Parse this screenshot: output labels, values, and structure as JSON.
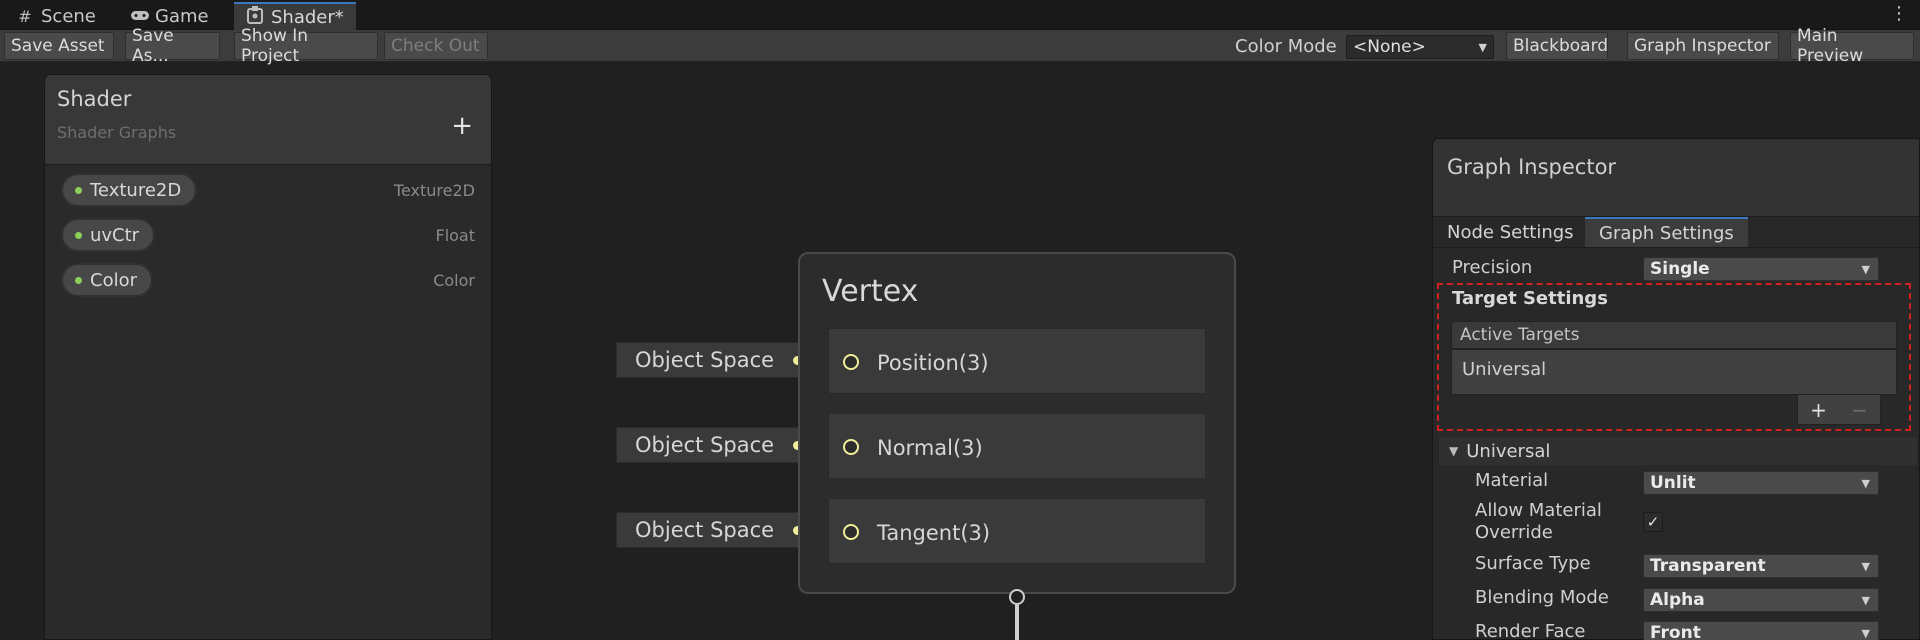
{
  "tabs": [
    {
      "label": "Scene",
      "icon": "hash-icon"
    },
    {
      "label": "Game",
      "icon": "gamepad-icon"
    },
    {
      "label": "Shader*",
      "icon": "shader-icon"
    }
  ],
  "toolbar": {
    "save_asset": "Save Asset",
    "save_as": "Save As...",
    "show_in_project": "Show In Project",
    "check_out": "Check Out",
    "color_mode_label": "Color Mode",
    "color_mode_value": "<None>",
    "blackboard": "Blackboard",
    "graph_inspector": "Graph Inspector",
    "main_preview": "Main Preview"
  },
  "blackboard": {
    "title": "Shader",
    "subtitle": "Shader Graphs",
    "properties": [
      {
        "name": "Texture2D",
        "type": "Texture2D"
      },
      {
        "name": "uvCtr",
        "type": "Float"
      },
      {
        "name": "Color",
        "type": "Color"
      }
    ]
  },
  "vertex_node": {
    "title": "Vertex",
    "slots": [
      {
        "label": "Position(3)",
        "input": "Object Space"
      },
      {
        "label": "Normal(3)",
        "input": "Object Space"
      },
      {
        "label": "Tangent(3)",
        "input": "Object Space"
      }
    ]
  },
  "inspector": {
    "title": "Graph Inspector",
    "tab_node": "Node Settings",
    "tab_graph": "Graph Settings",
    "precision_label": "Precision",
    "precision_value": "Single",
    "target_settings": "Target Settings",
    "active_targets": "Active Targets",
    "target_item": "Universal",
    "universal_section": "Universal",
    "material_label": "Material",
    "material_value": "Unlit",
    "allow_override_label_1": "Allow Material",
    "allow_override_label_2": "Override",
    "allow_override_checked": true,
    "surface_type_label": "Surface Type",
    "surface_type_value": "Transparent",
    "blending_mode_label": "Blending Mode",
    "blending_mode_value": "Alpha",
    "render_face_label": "Render Face",
    "render_face_value": "Front"
  },
  "colors": {
    "accent_tab": "#3a79bb",
    "port_wire": "#f1ee9b",
    "property_dot": "#8cd05c",
    "highlight_box": "#d02020"
  }
}
